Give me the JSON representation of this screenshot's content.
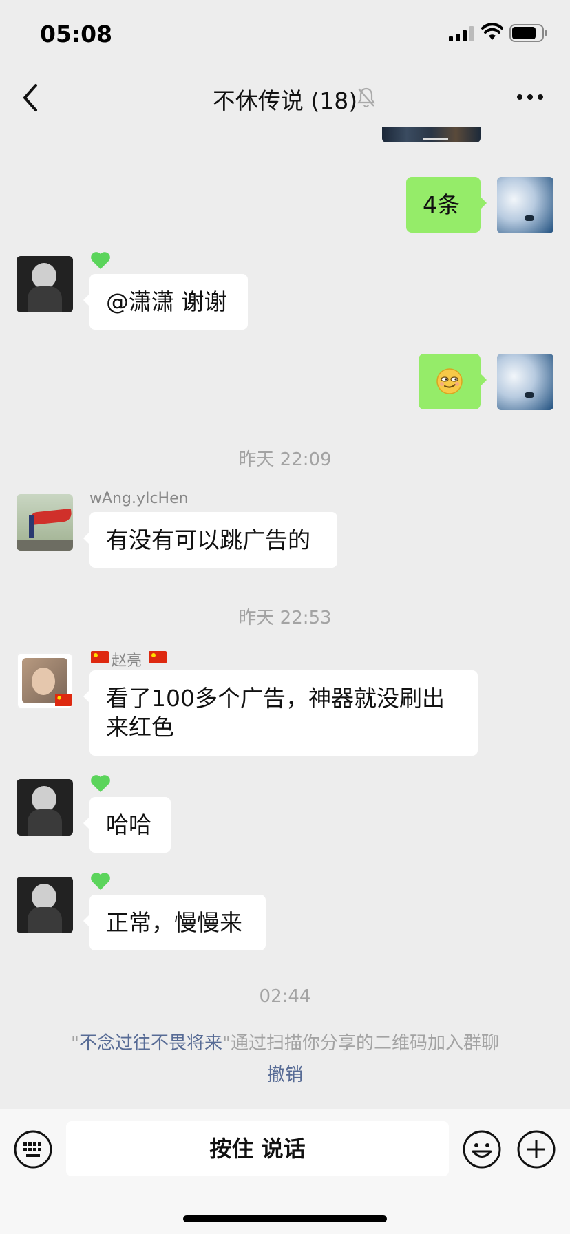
{
  "status_bar": {
    "time": "05:08"
  },
  "header": {
    "title": "不休传说 (18)"
  },
  "messages": [
    {
      "text": "4条"
    },
    {
      "sender": "",
      "text": "@潇潇 谢谢"
    },
    {
      "sender": "wAng.yIcHen",
      "text": "有没有可以跳广告的"
    },
    {
      "sender": "赵亮",
      "text": "看了100多个广告，神器就没刷出来红色"
    },
    {
      "sender": "",
      "text": "哈哈"
    },
    {
      "sender": "",
      "text": "正常，慢慢来"
    }
  ],
  "timestamps": [
    "昨天 22:09",
    "昨天 22:53",
    "02:44"
  ],
  "system_message": {
    "quote_open": "\"",
    "name": "不念过往不畏将来",
    "quote_close": "\"",
    "text": "通过扫描你分享的二维码加入群聊",
    "action": "撤销"
  },
  "input_bar": {
    "talk_label": "按住 说话"
  },
  "colors": {
    "self_bubble": "#95ec69",
    "background": "#ededed",
    "link": "#576b95"
  },
  "icons": [
    "back-chevron-icon",
    "mute-bell-icon",
    "more-icon",
    "keyboard-icon",
    "emoji-icon",
    "plus-icon",
    "green-heart-icon",
    "china-flag-icon",
    "smirk-emoji-icon"
  ]
}
